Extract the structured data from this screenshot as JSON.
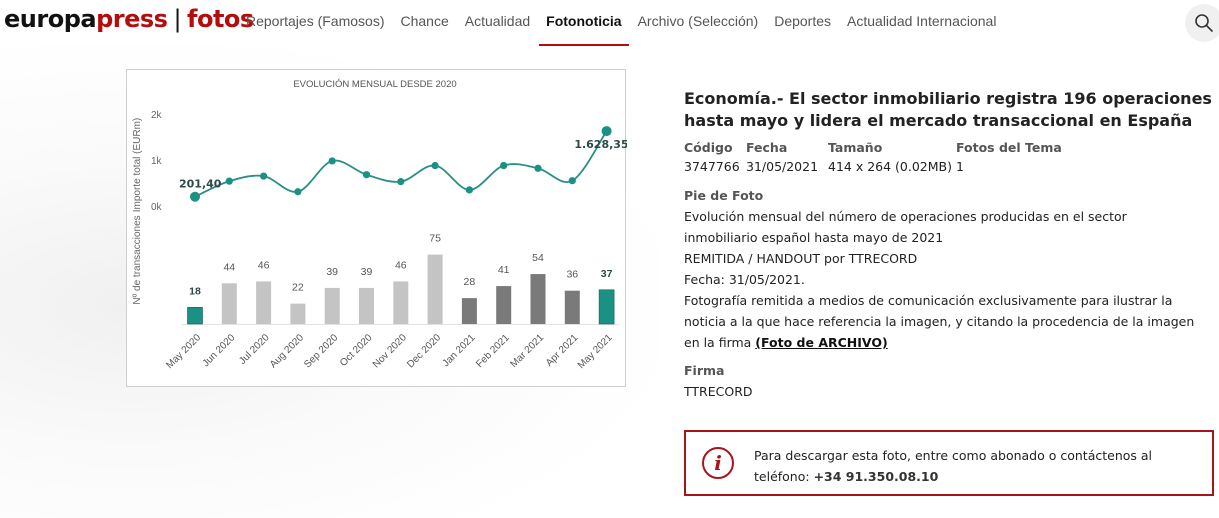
{
  "header": {
    "logo": {
      "part1": "europa",
      "part2": "press",
      "separator": "|",
      "part3": "fotos"
    },
    "nav": [
      {
        "label": "Reportajes (Famosos)",
        "active": false
      },
      {
        "label": "Chance",
        "active": false
      },
      {
        "label": "Actualidad",
        "active": false
      },
      {
        "label": "Fotonoticia",
        "active": true
      },
      {
        "label": "Archivo (Selección)",
        "active": false
      },
      {
        "label": "Deportes",
        "active": false
      },
      {
        "label": "Actualidad Internacional",
        "active": false
      }
    ],
    "search_icon": "search-icon"
  },
  "colors": {
    "brand_red": "#b30d0d",
    "alert_red": "#a8141b",
    "teal": "#1a9182",
    "bar_light": "#c4c4c4",
    "bar_dark": "#7a7a7a"
  },
  "photo": {
    "chart_data": {
      "type": "line+bar",
      "title": "EVOLUCIÓN MENSUAL DESDE 2020",
      "categories": [
        "May 2020",
        "Jun 2020",
        "Jul 2020",
        "Aug 2020",
        "Sep 2020",
        "Oct 2020",
        "Nov 2020",
        "Dec 2020",
        "Jan 2021",
        "Feb 2021",
        "Mar 2021",
        "Apr 2021",
        "May 2021"
      ],
      "line": {
        "ylabel": "Importe total (EURm)",
        "yticks": [
          "0k",
          "1k",
          "2k"
        ],
        "ylim": [
          0,
          2000
        ],
        "values": [
          201.4,
          540,
          650,
          310,
          980,
          680,
          530,
          880,
          350,
          880,
          820,
          550,
          1628.35
        ],
        "labels": {
          "first": "201,40",
          "last": "1.628,35"
        }
      },
      "bars": {
        "ylabel": "Nº de transacciones",
        "values": [
          18,
          44,
          46,
          22,
          39,
          39,
          46,
          75,
          28,
          41,
          54,
          36,
          37
        ],
        "groups": [
          "highlight",
          "light",
          "light",
          "light",
          "light",
          "light",
          "light",
          "light",
          "dark",
          "dark",
          "dark",
          "dark",
          "highlight"
        ]
      },
      "grid": false,
      "legend": "none"
    }
  },
  "info": {
    "title": "Economía.- El sector inmobiliario registra 196 operaciones hasta mayo y lidera el mercado transaccional en España",
    "meta": {
      "headers": [
        "Código",
        "Fecha",
        "Tamaño",
        "Fotos del Tema"
      ],
      "values": [
        "3747766",
        "31/05/2021",
        "414 x 264 (0.02MB)",
        "1"
      ]
    },
    "caption_label": "Pie de Foto",
    "caption_lines": [
      "Evolución mensual del número de operaciones producidas en el sector",
      "inmobiliario español hasta mayo de 2021",
      "REMITIDA / HANDOUT por TTRECORD",
      "Fecha: 31/05/2021.",
      "Fotografía remitida a medios de comunicación exclusivamente para ilustrar la",
      "noticia a la que hace referencia la imagen, y citando la procedencia de la imagen"
    ],
    "caption_last_prefix": "en la firma ",
    "caption_link": "(Foto de ARCHIVO)",
    "firma_label": "Firma",
    "firma_value": "TTRECORD"
  },
  "alert": {
    "icon": "info-icon",
    "text_line1": "Para descargar esta foto, entre como abonado o contáctenos al",
    "text_prefix": "teléfono: ",
    "phone": "+34 91.350.08.10"
  }
}
